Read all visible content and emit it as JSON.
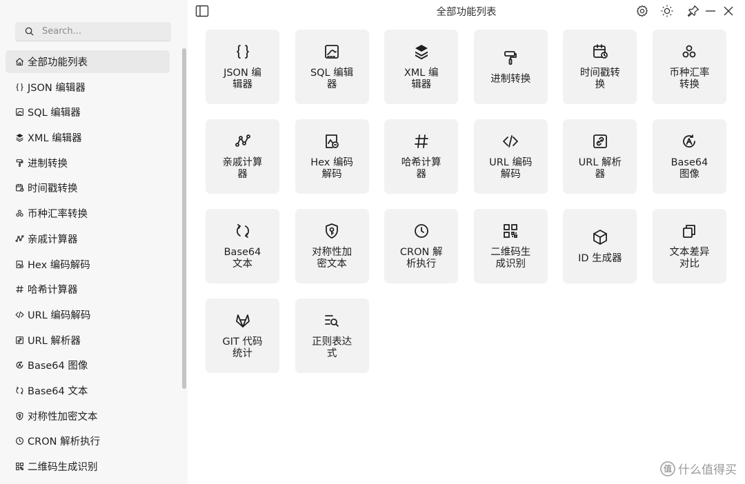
{
  "window": {
    "title": "全部功能列表"
  },
  "search": {
    "placeholder": "Search..."
  },
  "sidebar": {
    "items": [
      {
        "label": "全部功能列表",
        "icon": "home-icon"
      },
      {
        "label": "JSON 编辑器",
        "icon": "braces-icon"
      },
      {
        "label": "SQL 编辑器",
        "icon": "sql-icon"
      },
      {
        "label": "XML 编辑器",
        "icon": "layers-icon"
      },
      {
        "label": "进制转换",
        "icon": "paint-roller-icon"
      },
      {
        "label": "时间戳转换",
        "icon": "calendar-clock-icon"
      },
      {
        "label": "币种汇率转换",
        "icon": "triangle-circles-icon"
      },
      {
        "label": "亲戚计算器",
        "icon": "graph-icon"
      },
      {
        "label": "Hex 编码解码",
        "icon": "hex-image-icon"
      },
      {
        "label": "哈希计算器",
        "icon": "hash-icon"
      },
      {
        "label": "URL 编码解码",
        "icon": "code-icon"
      },
      {
        "label": "URL 解析器",
        "icon": "link-box-icon"
      },
      {
        "label": "Base64 图像",
        "icon": "base64-image-icon"
      },
      {
        "label": "Base64 文本",
        "icon": "refresh-icon"
      },
      {
        "label": "对称性加密文本",
        "icon": "shield-key-icon"
      },
      {
        "label": "CRON 解析执行",
        "icon": "clock-icon"
      },
      {
        "label": "二维码生成识别",
        "icon": "qrcode-icon"
      }
    ]
  },
  "cards": [
    {
      "label": "JSON 编辑器",
      "icon": "braces-icon"
    },
    {
      "label": "SQL 编辑器",
      "icon": "sql-icon"
    },
    {
      "label": "XML 编辑器",
      "icon": "layers-icon"
    },
    {
      "label": "进制转换",
      "icon": "paint-roller-icon"
    },
    {
      "label": "时间戳转换",
      "icon": "calendar-clock-icon"
    },
    {
      "label": "币种汇率转换",
      "icon": "triangle-circles-icon"
    },
    {
      "label": "亲戚计算器",
      "icon": "graph-icon"
    },
    {
      "label": "Hex 编码解码",
      "icon": "hex-image-icon"
    },
    {
      "label": "哈希计算器",
      "icon": "hash-icon"
    },
    {
      "label": "URL 编码解码",
      "icon": "code-icon"
    },
    {
      "label": "URL 解析器",
      "icon": "link-box-icon"
    },
    {
      "label": "Base64 图像",
      "icon": "base64-image-icon"
    },
    {
      "label": "Base64 文本",
      "icon": "refresh-icon"
    },
    {
      "label": "对称性加密文本",
      "icon": "shield-key-icon"
    },
    {
      "label": "CRON 解析执行",
      "icon": "clock-icon"
    },
    {
      "label": "二维码生成识别",
      "icon": "qrcode-icon"
    },
    {
      "label": "ID 生成器",
      "icon": "cube-icon"
    },
    {
      "label": "文本差异对比",
      "icon": "copy-icon"
    },
    {
      "label": "GIT 代码统计",
      "icon": "gitlab-icon"
    },
    {
      "label": "正则表达式",
      "icon": "regex-search-icon"
    }
  ],
  "titlebar": {
    "icons": [
      "sidebar-toggle-icon",
      "settings-icon",
      "theme-icon",
      "pin-icon",
      "minimize-icon",
      "close-icon"
    ]
  },
  "watermark": {
    "text": "什么值得买",
    "logo": "值"
  }
}
